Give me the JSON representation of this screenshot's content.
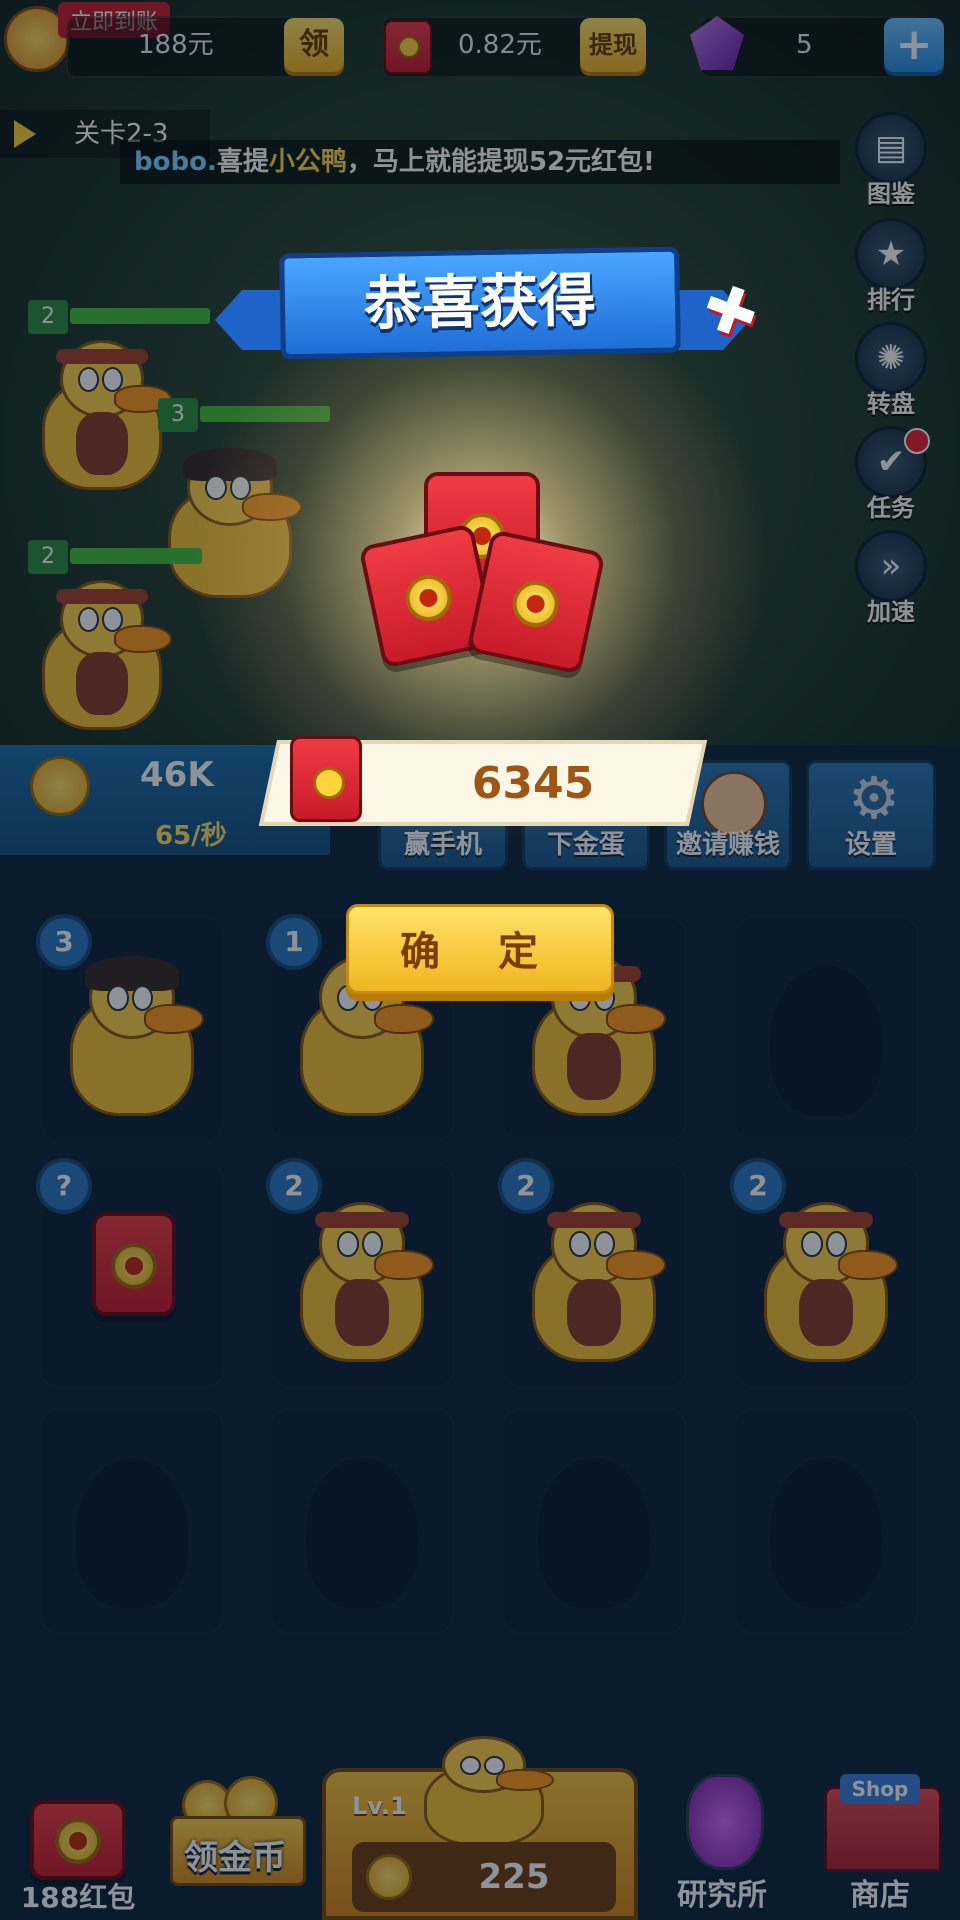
{
  "topbar": {
    "checkin_badge": "立即到账",
    "cash_value": "188元",
    "claim_label": "领",
    "redpacket_balance": "0.82元",
    "withdraw_label": "提现",
    "gem_count": "5",
    "add_label": "+"
  },
  "level": {
    "label": "关卡2-3"
  },
  "ticker": {
    "user": "bobo.",
    "prefix": "喜提",
    "item": "小公鸭",
    "suffix": "，马上就能提现52元红包!"
  },
  "side_menu": [
    {
      "label": "图鉴",
      "icon": "book-icon"
    },
    {
      "label": "排行",
      "icon": "trophy-icon"
    },
    {
      "label": "转盘",
      "icon": "wheel-icon"
    },
    {
      "label": "任务",
      "icon": "task-icon"
    },
    {
      "label": "加速",
      "icon": "fast-forward-icon"
    }
  ],
  "field_levels": [
    "2",
    "3",
    "2"
  ],
  "stats": {
    "coins": "46K",
    "rate": "65/秒"
  },
  "menu_tiles": [
    {
      "label": "赢手机"
    },
    {
      "label": "下金蛋"
    },
    {
      "label": "邀请赚钱"
    },
    {
      "label": "设置"
    }
  ],
  "popup": {
    "title": "恭喜获得",
    "amount": "6345",
    "confirm_label": "确 定",
    "close_icon": "close-icon"
  },
  "grid": {
    "row1_badges": [
      "3",
      "1",
      "",
      ""
    ],
    "row2_badges": [
      "?",
      "2",
      "2",
      "2"
    ]
  },
  "dock": {
    "redpacket_label": "188红包",
    "coins_label": "领金币",
    "buy_level": "Lv.1",
    "buy_price": "225",
    "research_label": "研究所",
    "shop_label": "商店",
    "shop_sign": "Shop"
  },
  "colors": {
    "accent_yellow": "#f3b21f",
    "banner_blue": "#1f6ed6",
    "redpacket_red": "#c81b2a",
    "amount_brown": "#9e5616"
  }
}
